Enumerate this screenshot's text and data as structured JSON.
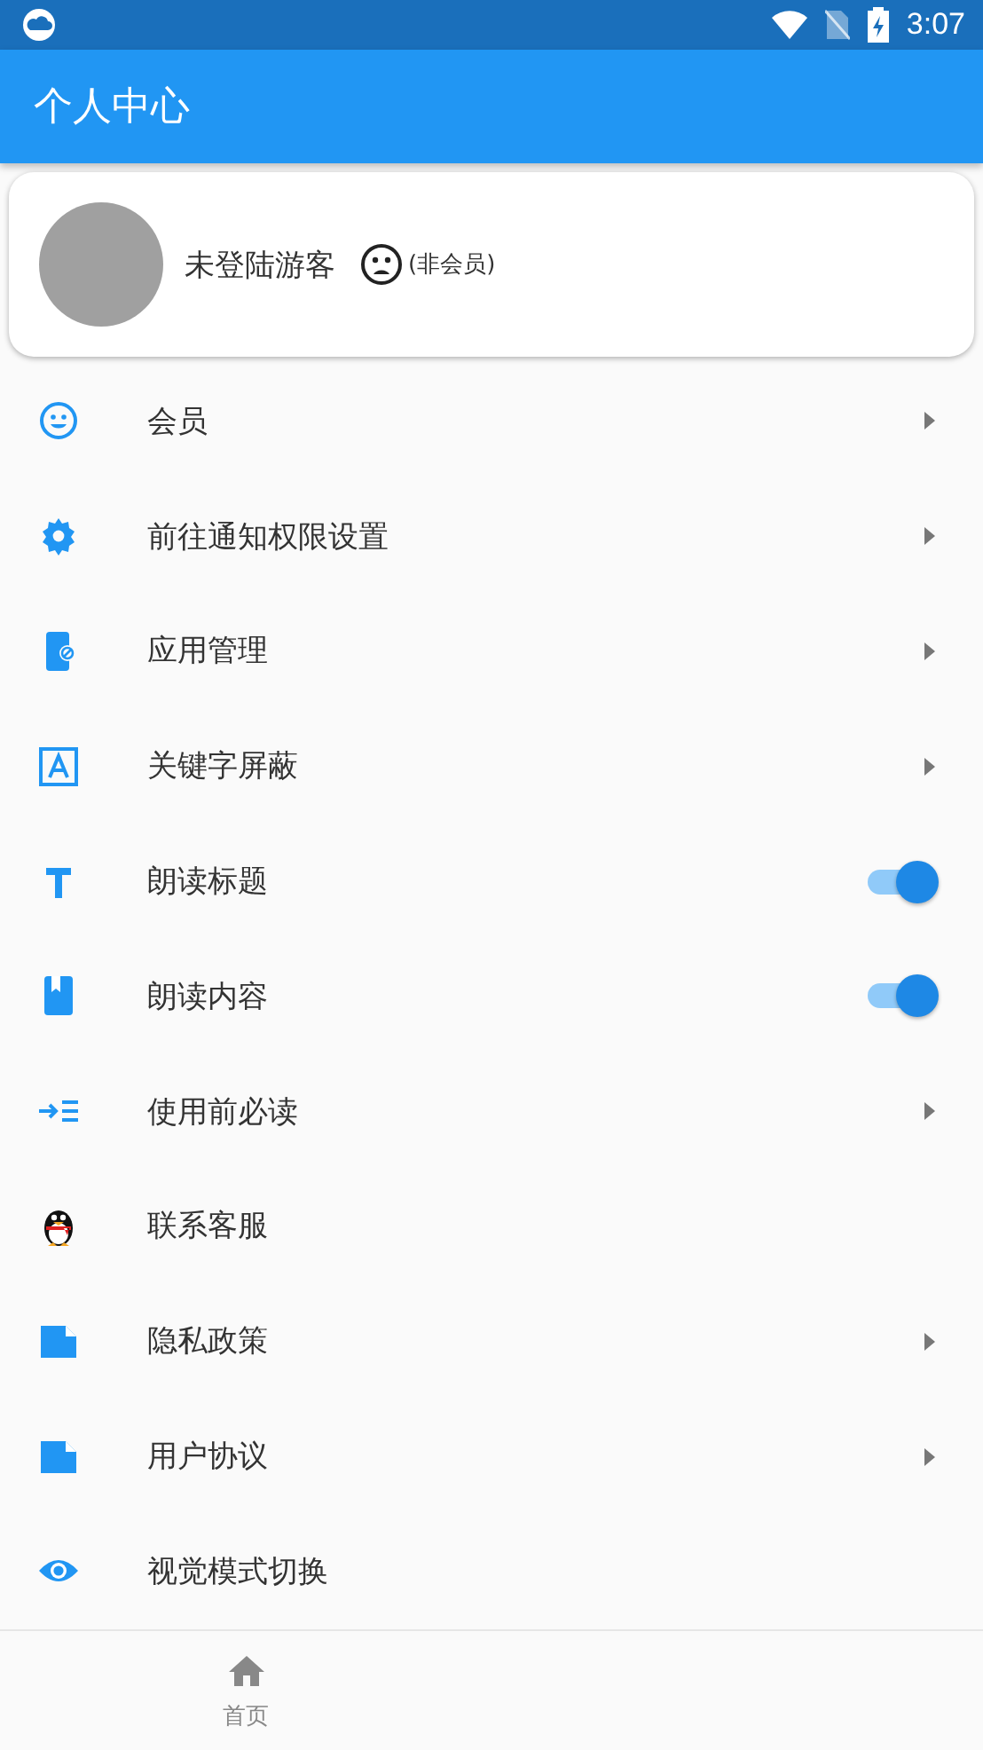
{
  "status_bar": {
    "time": "3:07"
  },
  "app_bar": {
    "title": "个人中心"
  },
  "profile": {
    "name": "未登陆游客",
    "membership": "(非会员)"
  },
  "menu": [
    {
      "label": "会员",
      "kind": "link"
    },
    {
      "label": "前往通知权限设置",
      "kind": "link"
    },
    {
      "label": "应用管理",
      "kind": "link"
    },
    {
      "label": "关键字屏蔽",
      "kind": "link"
    },
    {
      "label": "朗读标题",
      "kind": "toggle",
      "on": true
    },
    {
      "label": "朗读内容",
      "kind": "toggle",
      "on": true
    },
    {
      "label": "使用前必读",
      "kind": "link"
    },
    {
      "label": "联系客服",
      "kind": "plain"
    },
    {
      "label": "隐私政策",
      "kind": "link"
    },
    {
      "label": "用户协议",
      "kind": "link"
    },
    {
      "label": "视觉模式切换",
      "kind": "plain"
    }
  ],
  "bottom_nav": [
    {
      "label": "首页",
      "selected": false
    }
  ]
}
